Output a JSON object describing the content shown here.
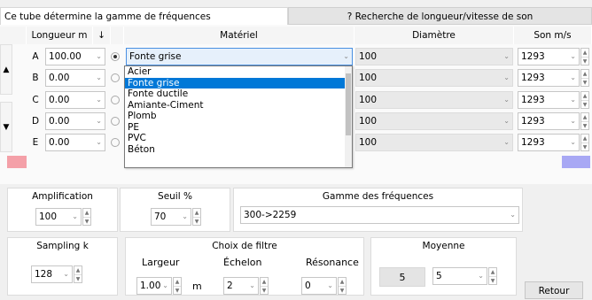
{
  "tabs": [
    {
      "label": "Ce tube détermine la gamme de fréquences"
    },
    {
      "label": "? Recherche de longueur/vitesse de son"
    }
  ],
  "grid": {
    "headers": {
      "longueur": "Longueur m",
      "sort": "↓",
      "materiel": "Matériel",
      "diametre": "Diamètre",
      "son": "Son m/s"
    },
    "rows": [
      {
        "label": "A",
        "longueur": "100.00",
        "materiel": "Fonte grise",
        "diametre": "100",
        "son": "1293"
      },
      {
        "label": "B",
        "longueur": "0.00",
        "materiel": "",
        "diametre": "100",
        "son": "1293"
      },
      {
        "label": "C",
        "longueur": "0.00",
        "materiel": "",
        "diametre": "100",
        "son": "1293"
      },
      {
        "label": "D",
        "longueur": "0.00",
        "materiel": "",
        "diametre": "100",
        "son": "1293"
      },
      {
        "label": "E",
        "longueur": "0.00",
        "materiel": "",
        "diametre": "100",
        "son": "1293"
      }
    ],
    "selected_row": "A"
  },
  "dropdown": {
    "options": [
      "Acier",
      "Fonte grise",
      "Fonte ductile",
      "Amiante-Ciment",
      "Plomb",
      "PE",
      "PVC",
      "Béton"
    ],
    "selected": "Fonte grise"
  },
  "controls": {
    "amplification": {
      "label": "Amplification",
      "value": "100"
    },
    "seuil": {
      "label": "Seuil %",
      "value": "70"
    },
    "gamme": {
      "label": "Gamme des fréquences",
      "value": "300->2259"
    },
    "sampling": {
      "label": "Sampling k",
      "value": "128"
    },
    "filtre": {
      "label": "Choix de filtre",
      "largeur": {
        "label": "Largeur",
        "value": "1.00",
        "unit": "m"
      },
      "echelon": {
        "label": "Échelon",
        "value": "2"
      },
      "resonance": {
        "label": "Résonance",
        "value": "0"
      }
    },
    "moyenne": {
      "label": "Moyenne",
      "display": "5",
      "value": "5"
    },
    "retour": "Retour"
  },
  "colors": {
    "accent": "#0078d7",
    "red_block": "#f4a0a8",
    "blue_block": "#a8a8f4"
  }
}
